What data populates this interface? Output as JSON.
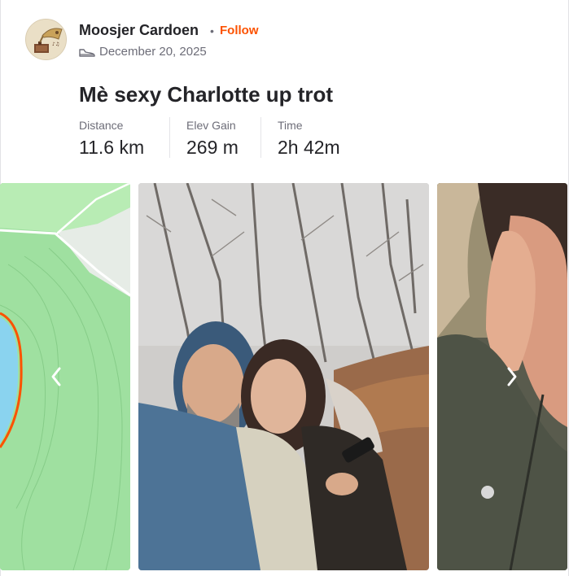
{
  "athlete": {
    "name": "Moosjer Cardoen",
    "follow_label": "Follow",
    "separator": "•"
  },
  "activity": {
    "date": "December 20, 2025",
    "type_icon": "shoe-icon",
    "title": "Mè sexy Charlotte up trot"
  },
  "stats": [
    {
      "label": "Distance",
      "value": "11.6 km"
    },
    {
      "label": "Elev Gain",
      "value": "269 m"
    },
    {
      "label": "Time",
      "value": "2h 42m"
    }
  ],
  "media": {
    "prev_icon": "chevron-left-icon",
    "next_icon": "chevron-right-icon",
    "items": [
      "route-map",
      "selfie-photo",
      "portrait-photo"
    ]
  },
  "colors": {
    "accent": "#fc5200",
    "text": "#242428",
    "muted": "#6d6d78",
    "map_green": "#98dc9a",
    "route": "#fc5200"
  }
}
